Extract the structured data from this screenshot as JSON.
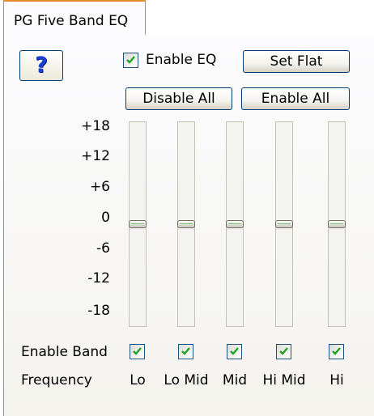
{
  "tab": {
    "label": "PG Five Band EQ"
  },
  "help_button": {
    "label": "?"
  },
  "enable_eq": {
    "label": "Enable EQ",
    "checked": true
  },
  "set_flat_button": {
    "label": "Set Flat"
  },
  "disable_all_button": {
    "label": "Disable All"
  },
  "enable_all_button": {
    "label": "Enable All"
  },
  "scale": [
    "+18",
    "+12",
    "+6",
    "0",
    "-6",
    "-12",
    "-18"
  ],
  "bands": [
    {
      "name": "Lo",
      "gain_db": 0,
      "enabled": true
    },
    {
      "name": "Lo Mid",
      "gain_db": 0,
      "enabled": true
    },
    {
      "name": "Mid",
      "gain_db": 0,
      "enabled": true
    },
    {
      "name": "Hi Mid",
      "gain_db": 0,
      "enabled": true
    },
    {
      "name": "Hi",
      "gain_db": 0,
      "enabled": true
    }
  ],
  "enable_band_label": "Enable Band",
  "frequency_label": "Frequency",
  "colors": {
    "check": "#21a121",
    "button_border": "#003c74",
    "tab_highlight": "#e68b2c"
  }
}
